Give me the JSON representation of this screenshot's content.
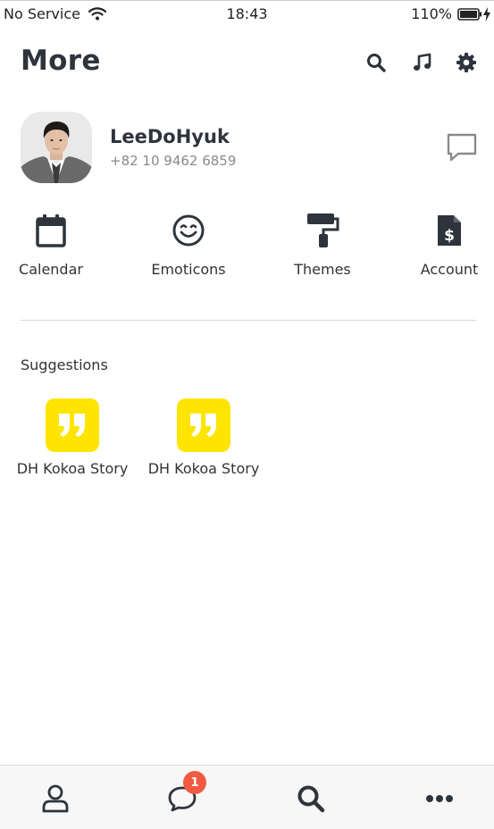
{
  "status_bar": {
    "carrier": "No Service",
    "time": "18:43",
    "battery": "110%"
  },
  "header": {
    "title": "More"
  },
  "profile": {
    "name": "LeeDoHyuk",
    "phone": "+82 10 9462 6859"
  },
  "quick_actions": [
    {
      "label": "Calendar",
      "icon": "calendar-icon"
    },
    {
      "label": "Emoticons",
      "icon": "smile-icon"
    },
    {
      "label": "Themes",
      "icon": "paint-roller-icon"
    },
    {
      "label": "Account",
      "icon": "invoice-dollar-icon"
    }
  ],
  "suggestions": {
    "title": "Suggestions",
    "items": [
      {
        "label": "DH Kokoa Story",
        "icon": "quote-icon"
      },
      {
        "label": "DH Kokoa Story",
        "icon": "quote-icon"
      }
    ]
  },
  "tabbar": {
    "chats_badge": "1"
  },
  "colors": {
    "accent_yellow": "#fee500",
    "badge_red": "#f15a42",
    "icon_dark": "#2e343b"
  }
}
